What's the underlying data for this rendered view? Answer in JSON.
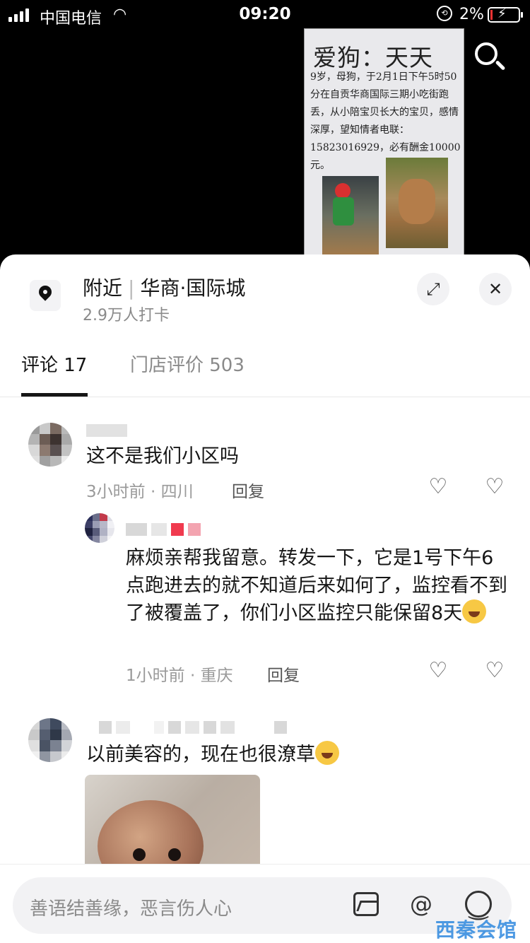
{
  "status": {
    "carrier": "中国电信",
    "time": "09:20",
    "battery": "2%"
  },
  "poster": {
    "title": "爱狗：天天",
    "text": "9岁，母狗，于2月1日下午5时50分在自贡华商国际三期小吃街跑丢，从小陪宝贝长大的宝贝，感情深厚，望知情者电联：15823016929，必有酬金10000元。"
  },
  "location": {
    "prefix": "附近",
    "name": "华商·国际城",
    "checkins": "2.9万人打卡"
  },
  "tabs": [
    {
      "label": "评论 17"
    },
    {
      "label": "门店评价 503"
    }
  ],
  "comments": [
    {
      "text": "这不是我们小区吗",
      "time_place": "3小时前 · 四川",
      "reply_label": "回复"
    },
    {
      "text": "麻烦亲帮我留意。转发一下，它是1号下午6点跑进去的就不知道后来如何了，监控看不到了被覆盖了，你们小区监控只能保留8天",
      "time_place": "1小时前 · 重庆",
      "reply_label": "回复"
    },
    {
      "text": "以前美容的，现在也很潦草"
    }
  ],
  "input": {
    "placeholder": "善语结善缘，恶言伤人心"
  },
  "watermark": "西秦会馆",
  "icons": {
    "location": "location-pin-icon",
    "expand": "expand-icon",
    "close": "close-icon",
    "like": "heart-icon",
    "dislike": "broken-heart-icon",
    "image": "image-icon",
    "mention": "at-icon",
    "emoji": "emoji-icon",
    "search": "search-icon"
  }
}
